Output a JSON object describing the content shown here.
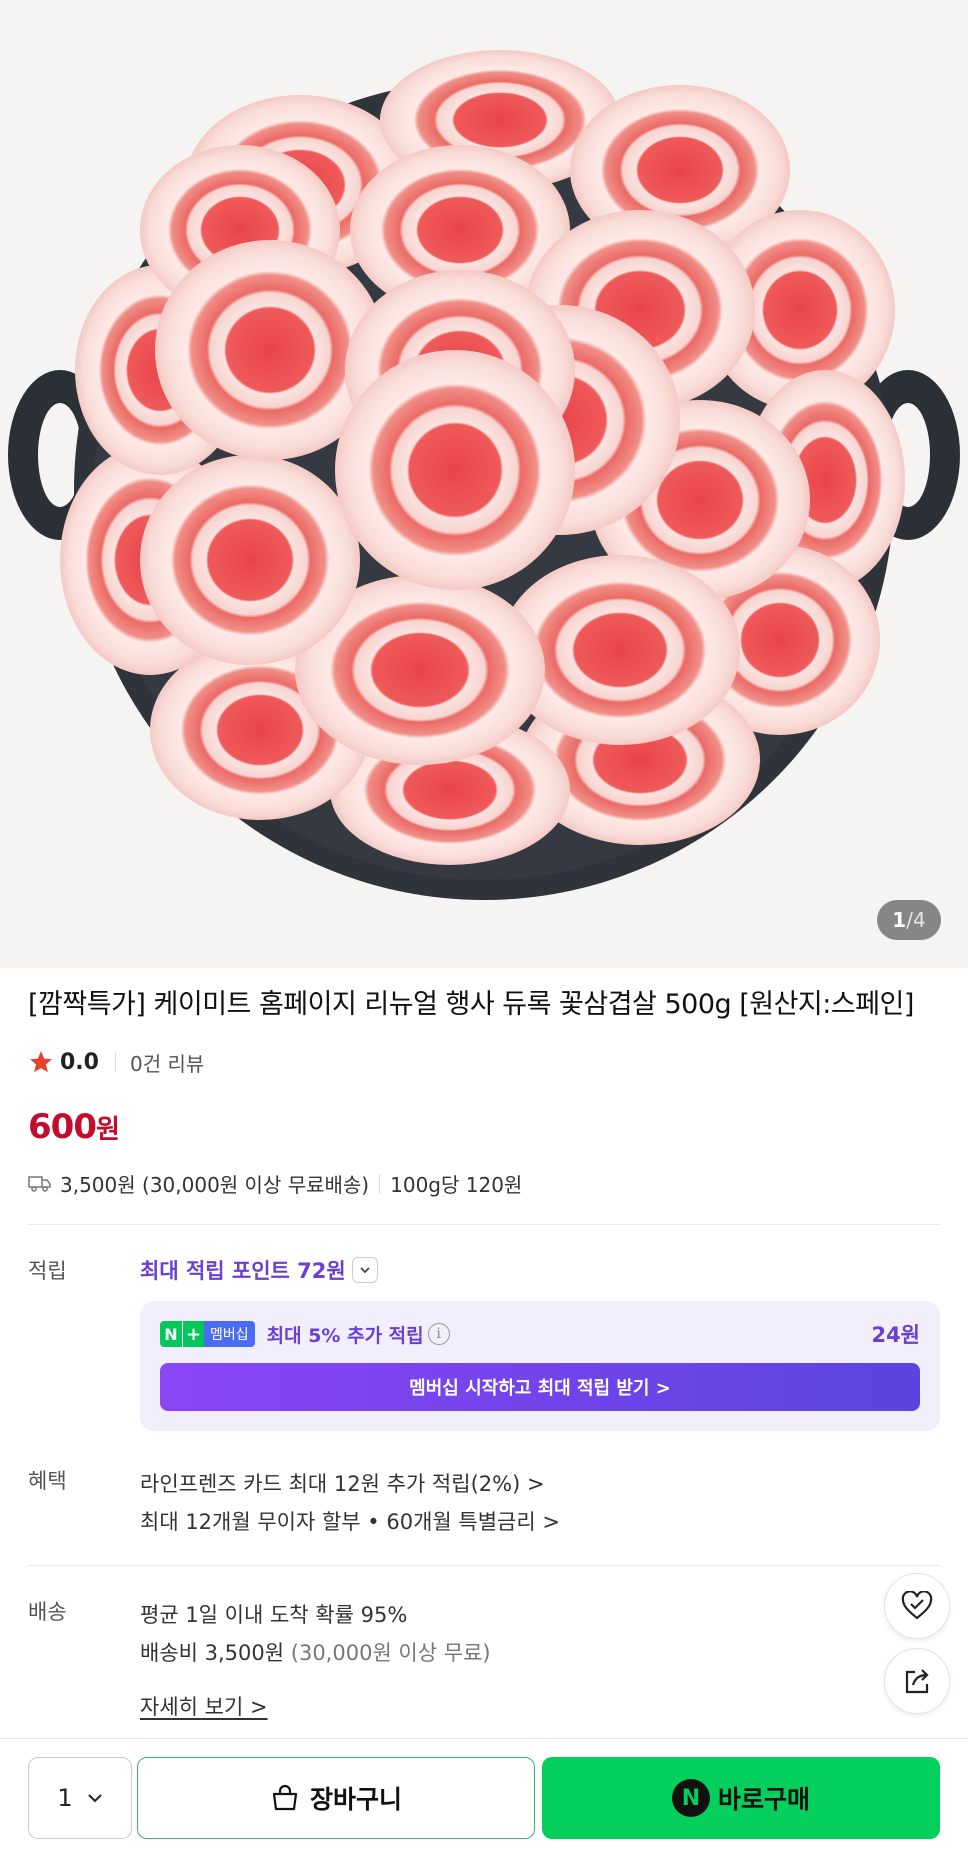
{
  "hero": {
    "image_alt": "꽃삼겹살 제품 이미지",
    "page_current": "1",
    "page_separator": "/",
    "page_total": "4"
  },
  "product": {
    "title": "[깜짝특가] 케이미트 홈페이지 리뉴얼 행사 듀록 꽃삼겹살 500g [원산지:스페인]",
    "rating": "0.0",
    "review_count": "0건 리뷰",
    "price": "600",
    "price_unit": "원",
    "shipping_fee": "3,500원 (30,000원 이상 무료배송)",
    "unit_price": "100g당 120원"
  },
  "points": {
    "label": "적립",
    "title": "최대 적립 포인트 72원",
    "membership_badge_n": "N",
    "membership_badge_plus": "+",
    "membership_badge_text": "멤버십",
    "membership_text": "최대 5% 추가 적립",
    "membership_amount": "24원",
    "membership_button": "멤버십 시작하고 최대 적립 받기 >"
  },
  "benefits": {
    "label": "혜택",
    "items": [
      "라인프렌즈 카드 최대 12원 추가 적립(2%) >",
      "최대 12개월 무이자 할부 • 60개월 특별금리 >"
    ]
  },
  "delivery": {
    "label": "배송",
    "arrival": "평균 1일 이내 도착 확률 95%",
    "fee_label": "배송비 3,500원",
    "fee_note": "(30,000원 이상 무료)",
    "more_link": "자세히 보기 >"
  },
  "bottom_bar": {
    "quantity": "1",
    "cart_label": "장바구니",
    "buy_n": "N",
    "buy_label": "바로구매"
  },
  "colors": {
    "price_red": "#c20d2c",
    "purple": "#6b3fd4",
    "naver_green": "#03cf5d"
  }
}
